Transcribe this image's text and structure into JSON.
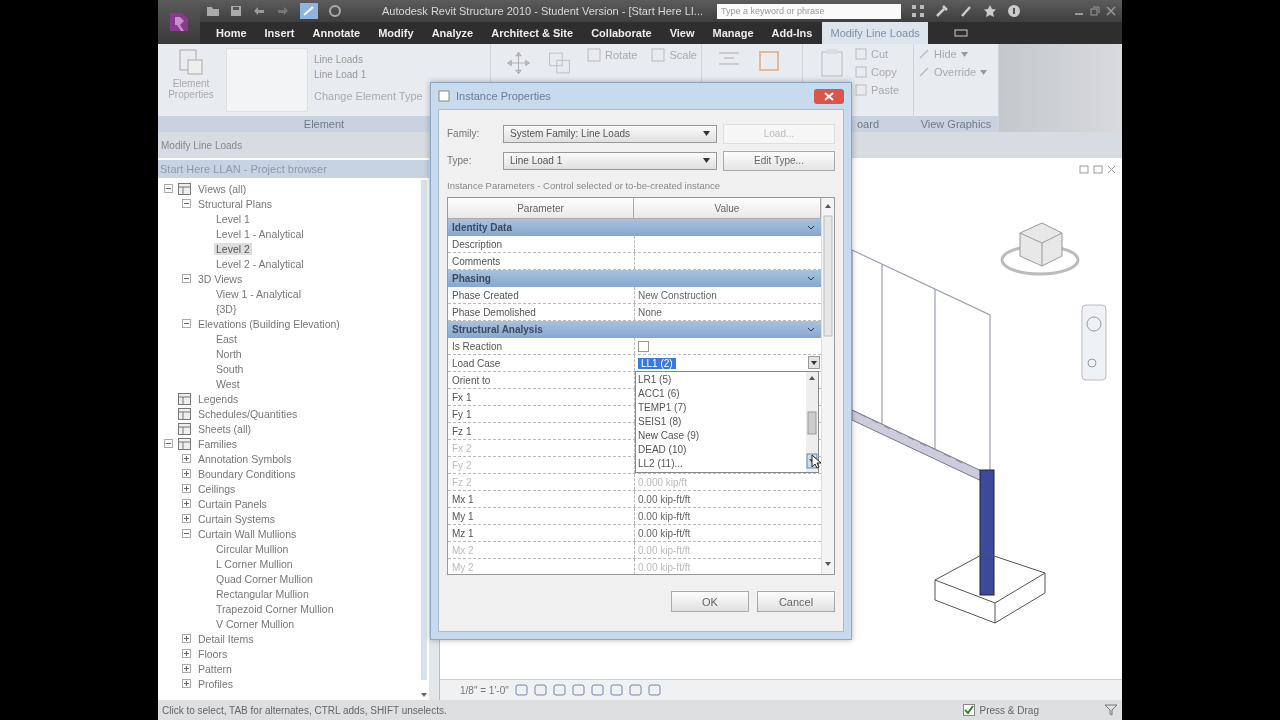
{
  "title_bar": {
    "title": "Autodesk Revit Structure 2010 - Student Version - [Start Here LI...",
    "search": {
      "placeholder": "Type a keyword or phrase"
    }
  },
  "ribbon_tabs": [
    {
      "label": "Home",
      "selected": false
    },
    {
      "label": "Insert",
      "selected": false
    },
    {
      "label": "Annotate",
      "selected": false
    },
    {
      "label": "Modify",
      "selected": false
    },
    {
      "label": "Analyze",
      "selected": false
    },
    {
      "label": "Architect & Site",
      "selected": false
    },
    {
      "label": "Collaborate",
      "selected": false
    },
    {
      "label": "View",
      "selected": false
    },
    {
      "label": "Manage",
      "selected": false
    },
    {
      "label": "Add-Ins",
      "selected": false
    },
    {
      "label": "Modify Line Loads",
      "selected": true
    }
  ],
  "ribbon": {
    "element_panel": {
      "button": "Element Properties",
      "type_family": "Line Loads",
      "type_name": "Line Load 1",
      "change_type": "Change Element Type",
      "label": "Element"
    },
    "modify_panel": {
      "tools": [
        "Rotate",
        "Scale"
      ]
    },
    "clipboard_panel": {
      "tools": [
        "Cut",
        "Copy",
        "Paste"
      ],
      "label": "oard"
    },
    "view_graphics_panel": {
      "tools": [
        "Hide",
        "Override"
      ],
      "label": "View Graphics"
    }
  },
  "options_bar": "Modify Line Loads",
  "project_browser": {
    "title": "Start Here LLAN - Project browser",
    "tree": [
      {
        "label": "Views (all)",
        "expanded": true,
        "selected": false,
        "children": [
          {
            "label": "Structural Plans",
            "expanded": true,
            "selected": false,
            "children": [
              {
                "label": "Level 1",
                "selected": false
              },
              {
                "label": "Level 1 - Analytical",
                "selected": false
              },
              {
                "label": "Level 2",
                "selected": true
              },
              {
                "label": "Level 2 - Analytical",
                "selected": false
              }
            ]
          },
          {
            "label": "3D Views",
            "expanded": true,
            "selected": false,
            "children": [
              {
                "label": "View 1 - Analytical",
                "selected": false
              },
              {
                "label": "{3D}",
                "selected": false
              }
            ]
          },
          {
            "label": "Elevations (Building Elevation)",
            "expanded": true,
            "selected": false,
            "children": [
              {
                "label": "East",
                "selected": false
              },
              {
                "label": "North",
                "selected": false
              },
              {
                "label": "South",
                "selected": false
              },
              {
                "label": "West",
                "selected": false
              }
            ]
          }
        ]
      },
      {
        "label": "Legends",
        "selected": false
      },
      {
        "label": "Schedules/Quantities",
        "selected": false
      },
      {
        "label": "Sheets (all)",
        "selected": false
      },
      {
        "label": "Families",
        "expanded": true,
        "selected": false,
        "children": [
          {
            "label": "Annotation Symbols",
            "expanded": false,
            "selected": false
          },
          {
            "label": "Boundary Conditions",
            "expanded": false,
            "selected": false
          },
          {
            "label": "Ceilings",
            "expanded": false,
            "selected": false
          },
          {
            "label": "Curtain Panels",
            "expanded": false,
            "selected": false
          },
          {
            "label": "Curtain Systems",
            "expanded": false,
            "selected": false
          },
          {
            "label": "Curtain Wall Mullions",
            "expanded": true,
            "selected": false,
            "children": [
              {
                "label": "Circular Mullion",
                "selected": false
              },
              {
                "label": "L Corner Mullion",
                "selected": false
              },
              {
                "label": "Quad Corner Mullion",
                "selected": false
              },
              {
                "label": "Rectangular Mullion",
                "selected": false
              },
              {
                "label": "Trapezoid Corner Mullion",
                "selected": false
              },
              {
                "label": "V Corner Mullion",
                "selected": false
              }
            ]
          },
          {
            "label": "Detail Items",
            "expanded": false,
            "selected": false
          },
          {
            "label": "Floors",
            "expanded": false,
            "selected": false
          },
          {
            "label": "Pattern",
            "expanded": false,
            "selected": false
          },
          {
            "label": "Profiles",
            "expanded": false,
            "selected": false
          }
        ]
      }
    ]
  },
  "view_control_bar": {
    "scale": "1/8\" = 1'-0\""
  },
  "status_bar": {
    "hint": "Click to select, TAB for alternates, CTRL adds, SHIFT unselects.",
    "press_drag": {
      "label": "Press & Drag",
      "checked": true
    }
  },
  "dialog": {
    "title": "Instance Properties",
    "family": {
      "label": "Family:",
      "value": "System Family: Line Loads"
    },
    "type": {
      "label": "Type:",
      "value": "Line Load 1"
    },
    "side_buttons": [
      {
        "label": "Load...",
        "disabled": true
      },
      {
        "label": "Edit Type...",
        "disabled": false
      }
    ],
    "caption": "Instance Parameters - Control selected or to-be-created instance",
    "columns": [
      "Parameter",
      "Value"
    ],
    "rows": [
      {
        "kind": "group",
        "name": "Identity Data"
      },
      {
        "kind": "param",
        "name": "Description",
        "disabled": false
      },
      {
        "kind": "param",
        "name": "Comments",
        "disabled": false
      },
      {
        "kind": "group",
        "name": "Phasing"
      },
      {
        "kind": "param",
        "name": "Phase Created",
        "value": "New Construction",
        "disabled": false
      },
      {
        "kind": "param",
        "name": "Phase Demolished",
        "value": "None",
        "disabled": false
      },
      {
        "kind": "group",
        "name": "Structural Analysis"
      },
      {
        "kind": "checkbox",
        "name": "Is Reaction",
        "checked": false,
        "disabled": false
      },
      {
        "kind": "combo",
        "name": "Load Case",
        "value": "LL1 (2)",
        "disabled": false
      },
      {
        "kind": "param",
        "name": "Orient to",
        "disabled": false
      },
      {
        "kind": "param",
        "name": "Fx 1",
        "disabled": false
      },
      {
        "kind": "param",
        "name": "Fy 1",
        "disabled": false
      },
      {
        "kind": "param",
        "name": "Fz 1",
        "disabled": false
      },
      {
        "kind": "param",
        "name": "Fx 2",
        "disabled": true
      },
      {
        "kind": "param",
        "name": "Fy 2",
        "disabled": true
      },
      {
        "kind": "param",
        "name": "Fz 2",
        "value": "0.000 kip/ft",
        "disabled": true
      },
      {
        "kind": "param",
        "name": "Mx 1",
        "value": "0.00 kip-ft/ft",
        "disabled": false
      },
      {
        "kind": "param",
        "name": "My 1",
        "value": "0.00 kip-ft/ft",
        "disabled": false
      },
      {
        "kind": "param",
        "name": "Mz 1",
        "value": "0.00 kip-ft/ft",
        "disabled": false
      },
      {
        "kind": "param",
        "name": "Mx 2",
        "value": "0.00 kip-ft/ft",
        "disabled": true
      },
      {
        "kind": "param",
        "name": "My 2",
        "value": "0.00 kip-ft/ft",
        "disabled": true
      }
    ],
    "dropdown": [
      {
        "label": "LR1 (5)",
        "selected": false
      },
      {
        "label": "ACC1 (6)",
        "selected": false
      },
      {
        "label": "TEMP1 (7)",
        "selected": false
      },
      {
        "label": "SEIS1 (8)",
        "selected": false
      },
      {
        "label": "New Case (9)",
        "selected": false
      },
      {
        "label": "DEAD (10)",
        "selected": false
      },
      {
        "label": "LL2 (11)...",
        "selected": false
      }
    ],
    "buttons": [
      "OK",
      "Cancel"
    ]
  }
}
